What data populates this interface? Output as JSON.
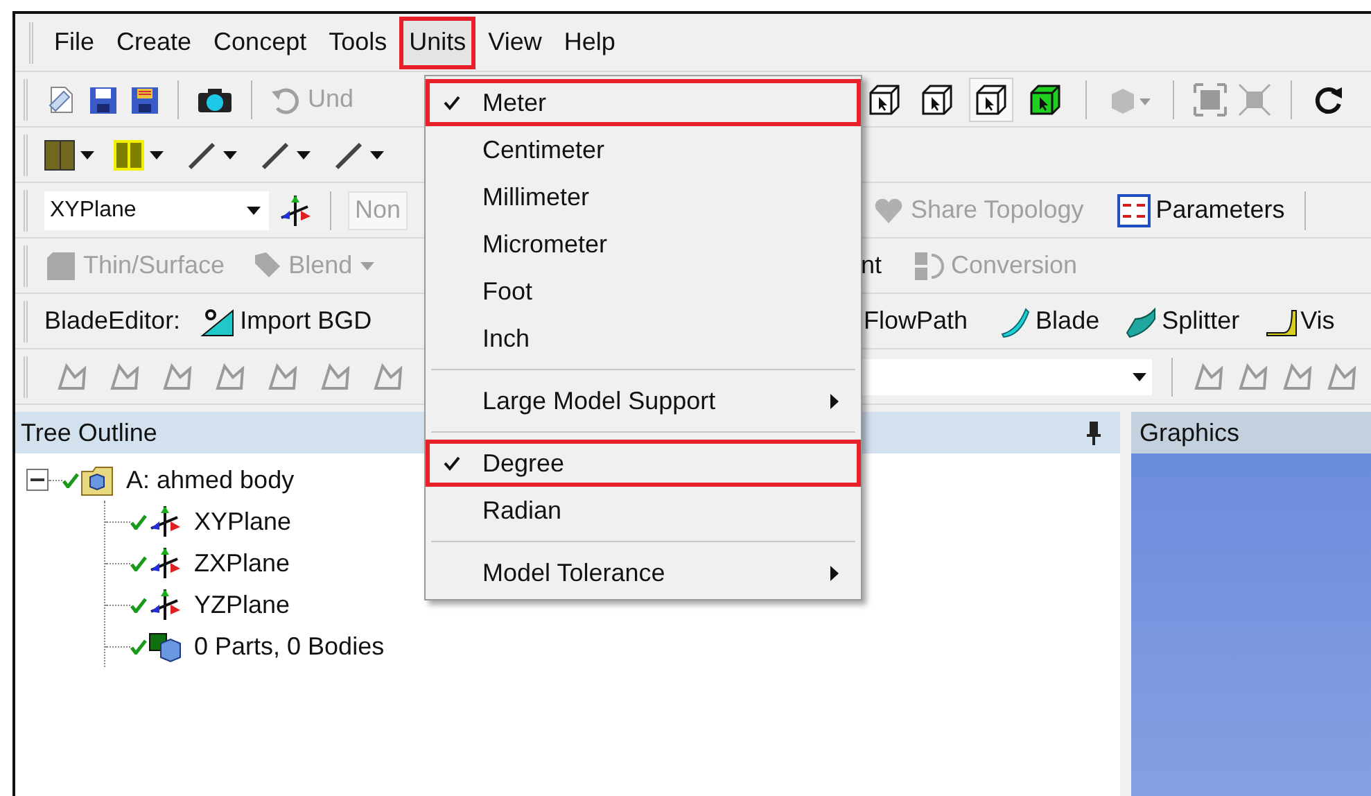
{
  "menubar": [
    {
      "label": "File",
      "selected": false,
      "highlighted": false
    },
    {
      "label": "Create",
      "selected": false,
      "highlighted": false
    },
    {
      "label": "Concept",
      "selected": false,
      "highlighted": false
    },
    {
      "label": "Tools",
      "selected": false,
      "highlighted": false
    },
    {
      "label": "Units",
      "selected": true,
      "highlighted": true
    },
    {
      "label": "View",
      "selected": false,
      "highlighted": false
    },
    {
      "label": "Help",
      "selected": false,
      "highlighted": false
    }
  ],
  "units_menu": [
    {
      "kind": "item",
      "label": "Meter",
      "checked": true,
      "highlighted": true
    },
    {
      "kind": "item",
      "label": "Centimeter",
      "checked": false,
      "highlighted": false
    },
    {
      "kind": "item",
      "label": "Millimeter",
      "checked": false,
      "highlighted": false
    },
    {
      "kind": "item",
      "label": "Micrometer",
      "checked": false,
      "highlighted": false
    },
    {
      "kind": "item",
      "label": "Foot",
      "checked": false,
      "highlighted": false
    },
    {
      "kind": "item",
      "label": "Inch",
      "checked": false,
      "highlighted": false
    },
    {
      "kind": "separator"
    },
    {
      "kind": "submenu",
      "label": "Large Model Support"
    },
    {
      "kind": "separator"
    },
    {
      "kind": "item",
      "label": "Degree",
      "checked": true,
      "highlighted": true
    },
    {
      "kind": "item",
      "label": "Radian",
      "checked": false,
      "highlighted": false
    },
    {
      "kind": "separator"
    },
    {
      "kind": "submenu",
      "label": "Model Tolerance"
    }
  ],
  "main_toolbar": {
    "undo": {
      "label": "Und",
      "disabled": true
    }
  },
  "plane_toolbar": {
    "plane_select": "XYPlane",
    "sketch_select": "Non",
    "share_topology": {
      "label": "Share Topology",
      "disabled": true
    },
    "parameters": {
      "label": "Parameters",
      "disabled": false
    }
  },
  "feature_toolbar": {
    "thin_surface": {
      "label": "Thin/Surface",
      "disabled": true
    },
    "blend": {
      "label": "Blend",
      "disabled": true
    },
    "partial": {
      "label": "nt",
      "disabled": false
    },
    "conversion": {
      "label": "Conversion",
      "disabled": true
    }
  },
  "blade_toolbar": {
    "title": "BladeEditor:",
    "import": {
      "label": "Import BGD"
    },
    "flowpath": {
      "label": "FlowPath"
    },
    "blade": {
      "label": "Blade"
    },
    "splitter": {
      "label": "Splitter"
    },
    "vis": {
      "label": "Vis"
    }
  },
  "tree": {
    "title": "Tree Outline",
    "root": {
      "label": "A: ahmed body",
      "expanded": true,
      "children": [
        {
          "kind": "plane",
          "label": "XYPlane"
        },
        {
          "kind": "plane",
          "label": "ZXPlane"
        },
        {
          "kind": "plane",
          "label": "YZPlane"
        },
        {
          "kind": "parts",
          "label": "0 Parts, 0 Bodies"
        }
      ]
    }
  },
  "graphics": {
    "title": "Graphics"
  }
}
